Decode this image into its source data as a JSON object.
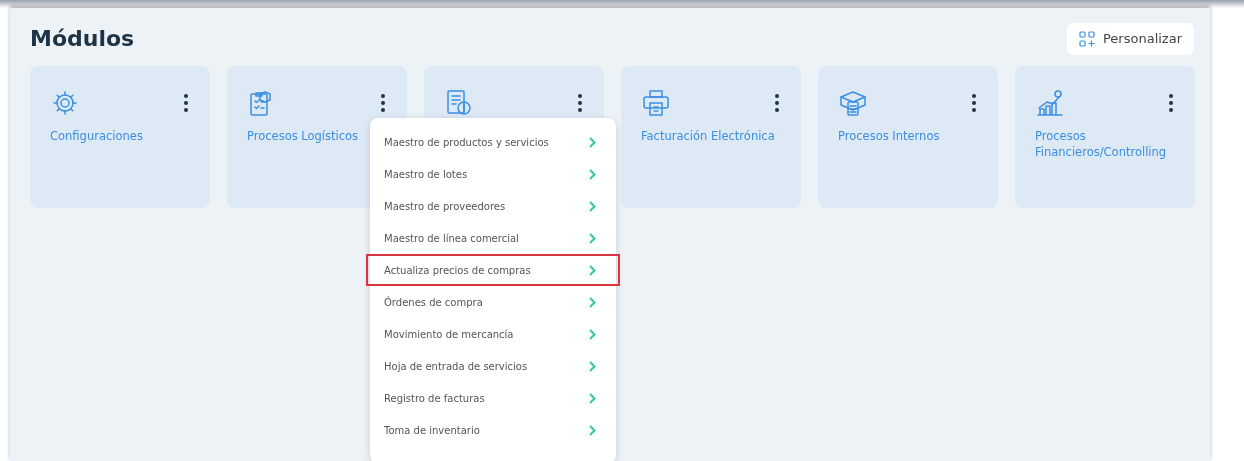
{
  "title": "Módulos",
  "customize_button": {
    "label": "Personalizar"
  },
  "modules": [
    {
      "kind": "gear",
      "label": "Configuraciones"
    },
    {
      "kind": "clipboard",
      "label": "Procesos Logísticos"
    },
    {
      "kind": "invoice"
    },
    {
      "kind": "printer",
      "label": "Facturación Electrónica"
    },
    {
      "kind": "box",
      "label": "Procesos Internos"
    },
    {
      "kind": "chart",
      "label": "Procesos Financieros/Controlling"
    }
  ],
  "menu": {
    "items": [
      {
        "label": "Maestro de productos y servicios",
        "highlighted": false
      },
      {
        "label": "Maestro de lotes",
        "highlighted": false
      },
      {
        "label": "Maestro de proveedores",
        "highlighted": false
      },
      {
        "label": "Maestro de línea comercial",
        "highlighted": false
      },
      {
        "label": "Actualiza precios de compras",
        "highlighted": true
      },
      {
        "label": "Órdenes de compra",
        "highlighted": false
      },
      {
        "label": "Movimiento de mercancía",
        "highlighted": false
      },
      {
        "label": "Hoja de entrada de servicios",
        "highlighted": false
      },
      {
        "label": "Registro de facturas",
        "highlighted": false
      },
      {
        "label": "Toma de inventario",
        "highlighted": false
      }
    ]
  }
}
